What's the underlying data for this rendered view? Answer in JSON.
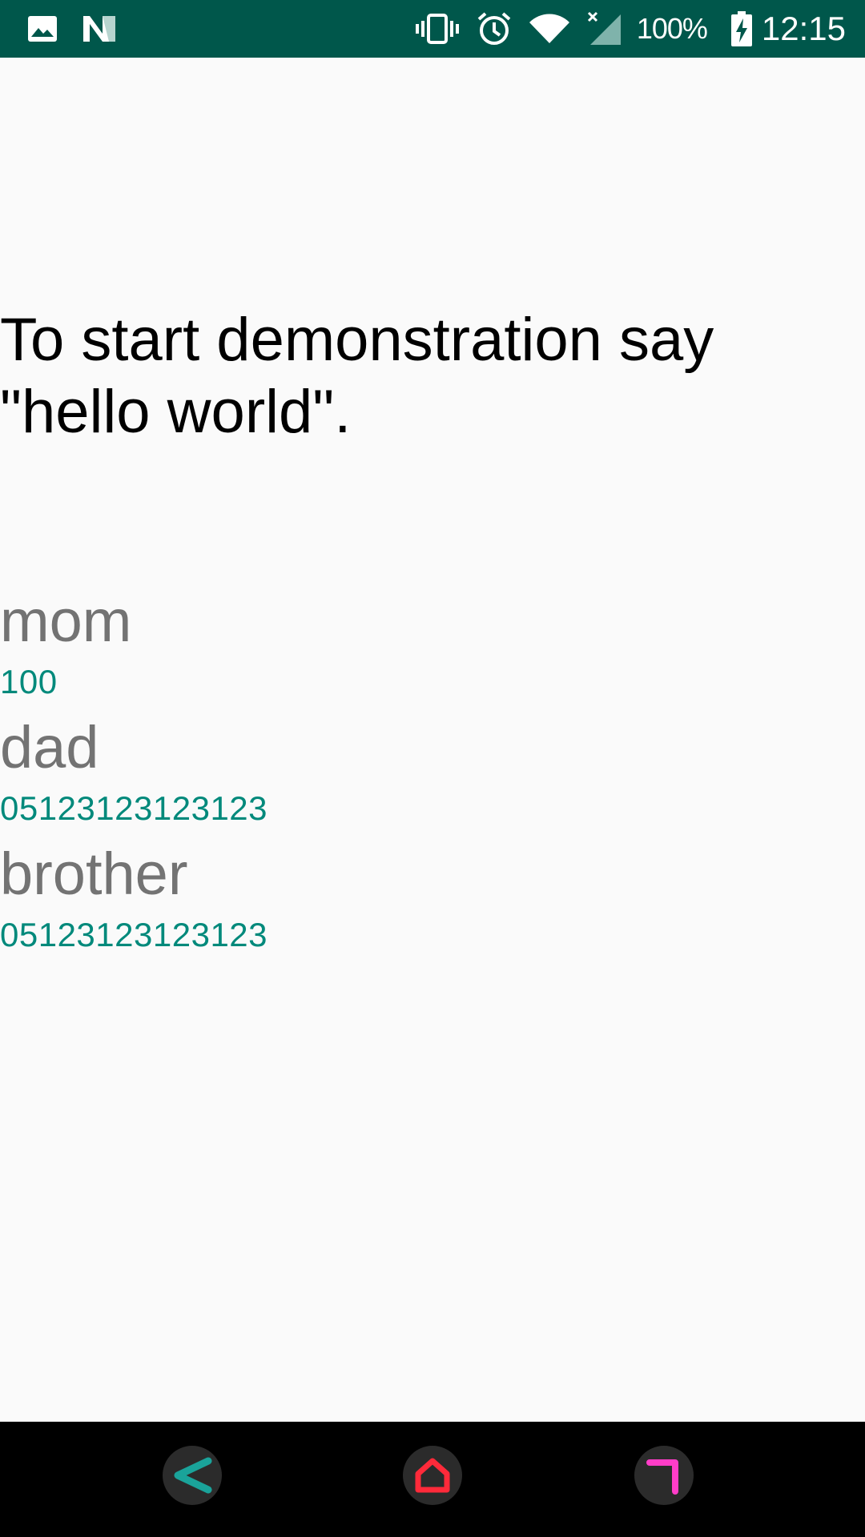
{
  "status_bar": {
    "left_icons": [
      "image-icon",
      "n-logo-icon"
    ],
    "right_icons": [
      "vibrate-icon",
      "alarm-icon",
      "wifi-icon",
      "signal-icon"
    ],
    "battery_percent": "100%",
    "time": "12:15",
    "background_color": "#00574b"
  },
  "main": {
    "instruction": "To start demonstration say \"hello world\".",
    "contacts": [
      {
        "name": "mom",
        "number": "100"
      },
      {
        "name": "dad",
        "number": "05123123123123"
      },
      {
        "name": "brother",
        "number": "05123123123123"
      }
    ],
    "name_color": "#737373",
    "number_color": "#00897b"
  },
  "nav_bar": {
    "buttons": [
      "back-icon",
      "home-icon",
      "recents-icon"
    ],
    "back_color": "#1aa39a",
    "home_color": "#ff2a3a",
    "recents_color": "#ff3dc8"
  }
}
